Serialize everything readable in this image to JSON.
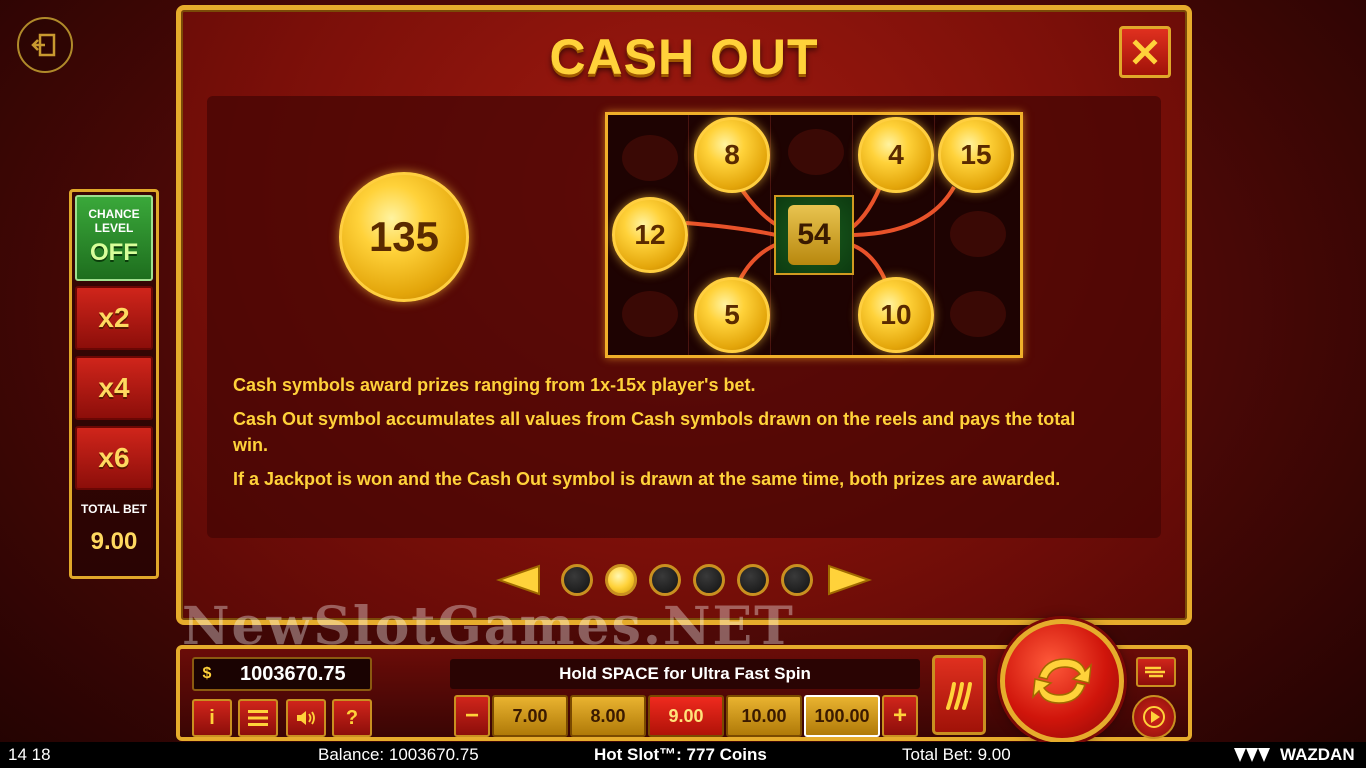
{
  "modal": {
    "title": "CASH OUT",
    "big_coin_value": "135",
    "reels": {
      "coins": [
        "8",
        "4",
        "15",
        "12",
        "5",
        "10"
      ],
      "cash_out_value": "54"
    },
    "rules": [
      "Cash symbols award prizes ranging from 1x-15x player's bet.",
      "Cash Out symbol accumulates all values from Cash symbols drawn on the reels and pays the total win.",
      "If a Jackpot is won and the Cash Out symbol is drawn at the same time, both prizes are awarded."
    ],
    "pager": {
      "page_count": 6,
      "active_page": 2
    }
  },
  "side_panel": {
    "chance_label_1": "CHANCE",
    "chance_label_2": "LEVEL",
    "chance_state": "OFF",
    "multipliers": [
      "x2",
      "x4",
      "x6"
    ],
    "total_bet_label": "TOTAL BET",
    "total_bet_value": "9.00"
  },
  "watermark": "NewSlotGames.NET",
  "controls": {
    "balance": "1003670.75",
    "hint": "Hold SPACE for Ultra Fast Spin",
    "minus_label": "−",
    "plus_label": "+",
    "bet_options": [
      "7.00",
      "8.00",
      "9.00",
      "10.00",
      "100.00"
    ],
    "selected_bet": "9.00",
    "info_label": "i",
    "help_label": "?"
  },
  "status_bar": {
    "time": "14 18",
    "balance": "Balance: 1003670.75",
    "game": "Hot Slot™: 777 Coins",
    "total_bet": "Total Bet: 9.00",
    "brand": "WAZDAN"
  },
  "colors": {
    "gold": "#ffd23a",
    "frame": "#e6ac2c",
    "red": "#d0251b",
    "green": "#3aa83a"
  }
}
